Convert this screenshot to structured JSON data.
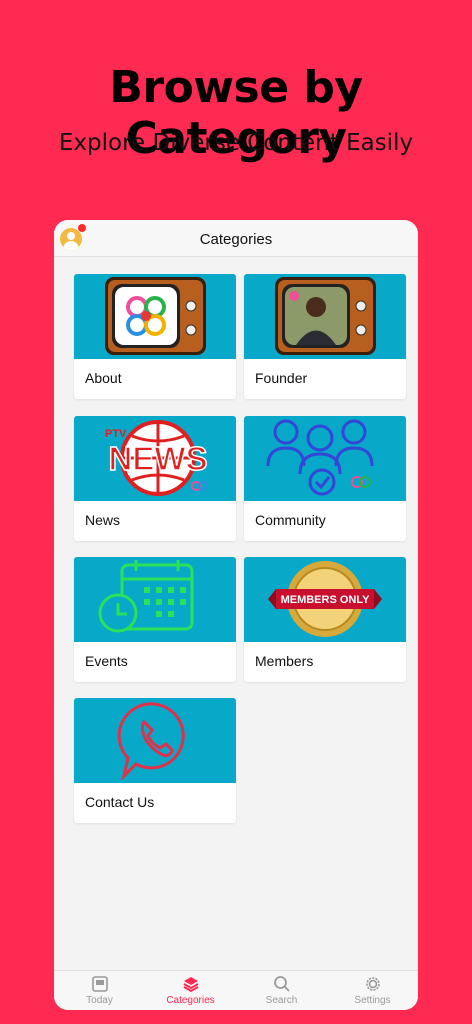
{
  "banner": {
    "title": "Browse by Category",
    "subtitle": "Explore Diverse Content Easily"
  },
  "nav": {
    "title": "Categories"
  },
  "categories": [
    {
      "label": "About",
      "icon": "tv-logo-icon"
    },
    {
      "label": "Founder",
      "icon": "tv-founder-icon"
    },
    {
      "label": "News",
      "icon": "news-icon",
      "thumb_text_1": "PTV",
      "thumb_text_2": "NEWS"
    },
    {
      "label": "Community",
      "icon": "community-icon"
    },
    {
      "label": "Events",
      "icon": "calendar-clock-icon"
    },
    {
      "label": "Members",
      "icon": "members-badge-icon",
      "thumb_text_1": "MEMBERS ONLY"
    },
    {
      "label": "Contact Us",
      "icon": "phone-chat-icon"
    }
  ],
  "tabs": [
    {
      "label": "Today",
      "icon": "today-icon",
      "active": false
    },
    {
      "label": "Categories",
      "icon": "layers-icon",
      "active": true
    },
    {
      "label": "Search",
      "icon": "search-icon",
      "active": false
    },
    {
      "label": "Settings",
      "icon": "gear-icon",
      "active": false
    }
  ],
  "colors": {
    "background": "#FF2A52",
    "thumb": "#08A8C8",
    "accent": "#FF2A52",
    "tab_inactive": "#9A9A9A"
  }
}
